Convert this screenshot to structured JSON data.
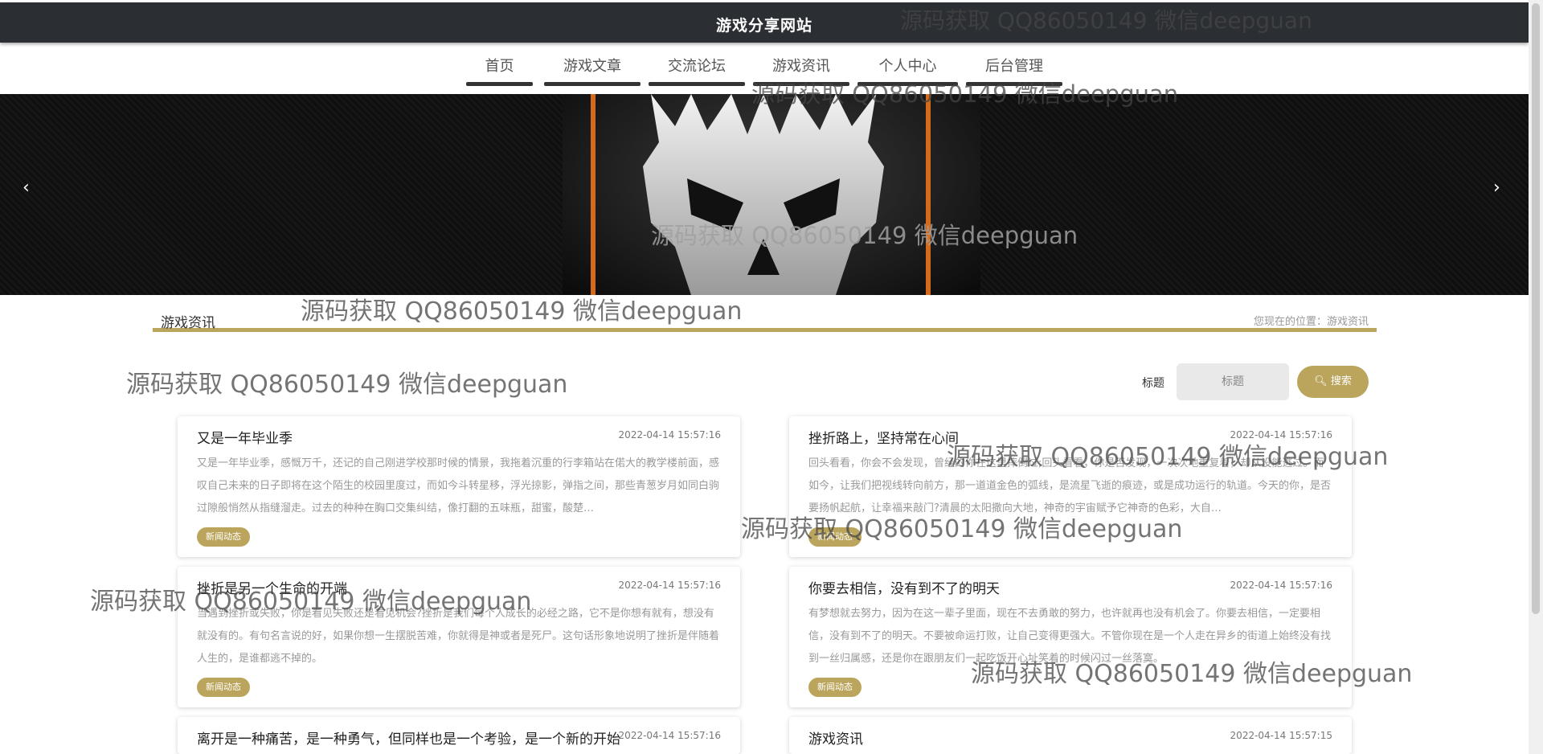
{
  "header": {
    "site_title": "游戏分享网站"
  },
  "nav": {
    "items": [
      {
        "label": "首页"
      },
      {
        "label": "游戏文章"
      },
      {
        "label": "交流论坛"
      },
      {
        "label": "游戏资讯"
      },
      {
        "label": "个人中心"
      },
      {
        "label": "后台管理"
      }
    ],
    "active": "游戏资讯"
  },
  "banner": {
    "prev": "‹",
    "next": "›"
  },
  "section": {
    "title": "游戏资讯",
    "breadcrumb": "您现在的位置：游戏资讯"
  },
  "search": {
    "label": "标题",
    "placeholder": "标题",
    "button": "搜索"
  },
  "articles": [
    {
      "title": "又是一年毕业季",
      "date": "2022-04-14 15:57:16",
      "body": "又是一年毕业季，感慨万千，还记的自己刚进学校那时候的情景，我拖着沉重的行李箱站在偌大的教学楼前面，感叹自己未来的日子即将在这个陌生的校园里度过，而如今斗转星移，浮光掠影，弹指之间，那些青葱岁月如同白驹过隙般悄然从指缝溜走。过去的种种在胸口交集纠结，像打翻的五味瓶，甜蜜，酸楚…",
      "tag": "新闻动态"
    },
    {
      "title": "挫折路上，坚持常在心间",
      "date": "2022-04-14 15:57:16",
      "body": "回头看看，你会不会发现，曾经的你在这里摔倒过;回头看看，你是否发现，一次次地重复着，却从没能逃过。而如今，让我们把视线转向前方，那一道道金色的弧线，是流星飞逝的痕迹，或是成功运行的轨道。今天的你，是否要扬帆起航，让幸福来敲门?清晨的太阳撒向大地，神奇的宇宙赋予它神奇的色彩，大自…",
      "tag": "新闻动态"
    },
    {
      "title": "挫折是另一个生命的开端",
      "date": "2022-04-14 15:57:16",
      "body": "当遇到挫折或失败，你是看见失败还是看见机会?挫折是我们每个人成长的必经之路，它不是你想有就有，想没有就没有的。有句名言说的好，如果你想一生摆脱苦难，你就得是神或者是死尸。这句话形象地说明了挫折是伴随着人生的，是谁都逃不掉的。",
      "tag": "新闻动态"
    },
    {
      "title": "你要去相信，没有到不了的明天",
      "date": "2022-04-14 15:57:16",
      "body": "有梦想就去努力，因为在这一辈子里面，现在不去勇敢的努力，也许就再也没有机会了。你要去相信，一定要相信，没有到不了的明天。不要被命运打败，让自己变得更强大。不管你现在是一个人走在异乡的街道上始终没有找到一丝归属感，还是你在跟朋友们一起吃饭开心址笑着的时候闪过一丝落寞。",
      "tag": "新闻动态"
    },
    {
      "title": "离开是一种痛苦，是一种勇气，但同样也是一个考验，是一个新的开始",
      "date": "2022-04-14 15:57:16",
      "body": "",
      "tag": ""
    },
    {
      "title": "游戏资讯",
      "date": "2022-04-14 15:57:15",
      "body": "",
      "tag": ""
    }
  ],
  "watermark": "源码获取 QQ86050149 微信deepguan"
}
